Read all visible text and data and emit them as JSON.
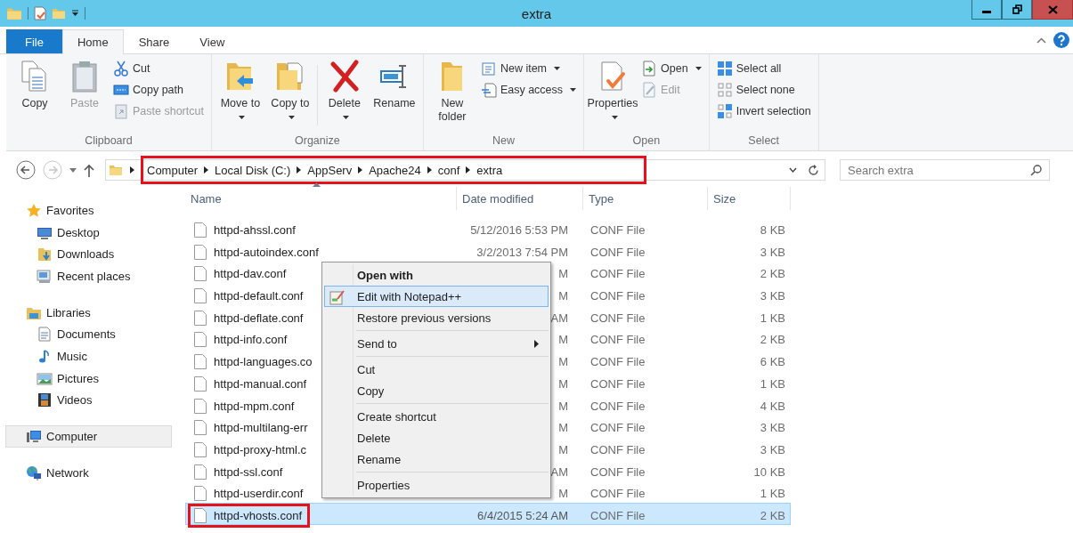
{
  "window": {
    "title": "extra"
  },
  "tabs": [
    {
      "label": "File",
      "kind": "file",
      "selected": false
    },
    {
      "label": "Home",
      "kind": "tab",
      "selected": true
    },
    {
      "label": "Share",
      "kind": "tab",
      "selected": false
    },
    {
      "label": "View",
      "kind": "tab",
      "selected": false
    }
  ],
  "ribbon": {
    "groups": [
      {
        "label": "Clipboard",
        "items": [
          {
            "kind": "large",
            "label": "Copy",
            "disabled": false,
            "dropdown": false
          },
          {
            "kind": "large",
            "label": "Paste",
            "disabled": true,
            "dropdown": false
          },
          {
            "kind": "stack",
            "items": [
              {
                "label": "Cut",
                "disabled": false,
                "dropdown": false
              },
              {
                "label": "Copy path",
                "disabled": false,
                "dropdown": false
              },
              {
                "label": "Paste shortcut",
                "disabled": true,
                "dropdown": false
              }
            ]
          }
        ]
      },
      {
        "label": "Organize",
        "items": [
          {
            "kind": "large",
            "label": "Move to",
            "disabled": false,
            "dropdown": true
          },
          {
            "kind": "large",
            "label": "Copy to",
            "disabled": false,
            "dropdown": true
          },
          {
            "kind": "separator"
          },
          {
            "kind": "large",
            "label": "Delete",
            "disabled": false,
            "dropdown": true
          },
          {
            "kind": "large",
            "label": "Rename",
            "disabled": false,
            "dropdown": false
          }
        ]
      },
      {
        "label": "New",
        "items": [
          {
            "kind": "large",
            "label": "New folder",
            "disabled": false,
            "dropdown": false
          },
          {
            "kind": "stack",
            "items": [
              {
                "label": "New item",
                "disabled": false,
                "dropdown": true
              },
              {
                "label": "Easy access",
                "disabled": false,
                "dropdown": true
              }
            ]
          }
        ]
      },
      {
        "label": "Open",
        "items": [
          {
            "kind": "large",
            "label": "Properties",
            "disabled": false,
            "dropdown": true
          },
          {
            "kind": "stack",
            "items": [
              {
                "label": "Open",
                "disabled": false,
                "dropdown": true
              },
              {
                "label": "Edit",
                "disabled": true,
                "dropdown": false
              }
            ]
          }
        ]
      },
      {
        "label": "Select",
        "items": [
          {
            "kind": "stack",
            "items": [
              {
                "label": "Select all",
                "disabled": false,
                "dropdown": false
              },
              {
                "label": "Select none",
                "disabled": false,
                "dropdown": false
              },
              {
                "label": "Invert selection",
                "disabled": false,
                "dropdown": false
              }
            ]
          }
        ]
      }
    ]
  },
  "address": {
    "crumbs": [
      "Computer",
      "Local Disk (C:)",
      "AppServ",
      "Apache24",
      "conf",
      "extra"
    ],
    "highlighted": true
  },
  "search": {
    "placeholder": "Search extra"
  },
  "nav": {
    "groups": [
      {
        "label": "Favorites",
        "selected": false,
        "children": [
          {
            "label": "Desktop",
            "selected": false
          },
          {
            "label": "Downloads",
            "selected": false
          },
          {
            "label": "Recent places",
            "selected": false
          }
        ]
      },
      {
        "label": "Libraries",
        "selected": false,
        "children": [
          {
            "label": "Documents",
            "selected": false
          },
          {
            "label": "Music",
            "selected": false
          },
          {
            "label": "Pictures",
            "selected": false
          },
          {
            "label": "Videos",
            "selected": false
          }
        ]
      },
      {
        "label": "Computer",
        "selected": true
      },
      {
        "label": "Network",
        "selected": false
      }
    ]
  },
  "files": {
    "columns": [
      {
        "label": "Name",
        "sorted": true
      },
      {
        "label": "Date modified",
        "sorted": false
      },
      {
        "label": "Type",
        "sorted": false
      },
      {
        "label": "Size",
        "sorted": false
      }
    ],
    "rows": [
      {
        "name": "httpd-ahssl.conf",
        "date": "5/12/2016 5:53 PM",
        "type": "CONF File",
        "size": "8 KB",
        "selected": false,
        "highlighted": false
      },
      {
        "name": "httpd-autoindex.conf",
        "date": "3/2/2013 7:54 PM",
        "type": "CONF File",
        "size": "3 KB",
        "selected": false,
        "highlighted": false
      },
      {
        "name": "httpd-dav.conf",
        "date": "M",
        "type": "CONF File",
        "size": "2 KB",
        "selected": false,
        "highlighted": false
      },
      {
        "name": "httpd-default.conf",
        "date": "M",
        "type": "CONF File",
        "size": "3 KB",
        "selected": false,
        "highlighted": false
      },
      {
        "name": "httpd-deflate.conf",
        "date": "AM",
        "type": "CONF File",
        "size": "1 KB",
        "selected": false,
        "highlighted": false
      },
      {
        "name": "httpd-info.conf",
        "date": "M",
        "type": "CONF File",
        "size": "2 KB",
        "selected": false,
        "highlighted": false
      },
      {
        "name": "httpd-languages.co",
        "date": "M",
        "type": "CONF File",
        "size": "6 KB",
        "selected": false,
        "highlighted": false
      },
      {
        "name": "httpd-manual.conf",
        "date": "M",
        "type": "CONF File",
        "size": "1 KB",
        "selected": false,
        "highlighted": false
      },
      {
        "name": "httpd-mpm.conf",
        "date": "M",
        "type": "CONF File",
        "size": "4 KB",
        "selected": false,
        "highlighted": false
      },
      {
        "name": "httpd-multilang-err",
        "date": "M",
        "type": "CONF File",
        "size": "3 KB",
        "selected": false,
        "highlighted": false
      },
      {
        "name": "httpd-proxy-html.c",
        "date": "M",
        "type": "CONF File",
        "size": "3 KB",
        "selected": false,
        "highlighted": false
      },
      {
        "name": "httpd-ssl.conf",
        "date": "AM",
        "type": "CONF File",
        "size": "10 KB",
        "selected": false,
        "highlighted": false
      },
      {
        "name": "httpd-userdir.conf",
        "date": "M",
        "type": "CONF File",
        "size": "1 KB",
        "selected": false,
        "highlighted": false
      },
      {
        "name": "httpd-vhosts.conf",
        "date": "6/4/2015 5:24 AM",
        "type": "CONF File",
        "size": "2 KB",
        "selected": true,
        "highlighted": true
      }
    ]
  },
  "context_menu": {
    "sections": [
      [
        {
          "label": "Open with",
          "kind": "command",
          "default": true,
          "selected": false,
          "submenu": false
        },
        {
          "label": "Edit with Notepad++",
          "kind": "app-command",
          "default": false,
          "selected": true,
          "submenu": false
        },
        {
          "label": "Restore previous versions",
          "kind": "command",
          "default": false,
          "selected": false,
          "submenu": false
        }
      ],
      [
        {
          "label": "Send to",
          "kind": "command",
          "default": false,
          "selected": false,
          "submenu": true
        }
      ],
      [
        {
          "label": "Cut",
          "kind": "command",
          "default": false,
          "selected": false,
          "submenu": false
        },
        {
          "label": "Copy",
          "kind": "command",
          "default": false,
          "selected": false,
          "submenu": false
        }
      ],
      [
        {
          "label": "Create shortcut",
          "kind": "command",
          "default": false,
          "selected": false,
          "submenu": false
        },
        {
          "label": "Delete",
          "kind": "command",
          "default": false,
          "selected": false,
          "submenu": false
        },
        {
          "label": "Rename",
          "kind": "command",
          "default": false,
          "selected": false,
          "submenu": false
        }
      ],
      [
        {
          "label": "Properties",
          "kind": "command",
          "default": false,
          "selected": false,
          "submenu": false
        }
      ]
    ]
  }
}
